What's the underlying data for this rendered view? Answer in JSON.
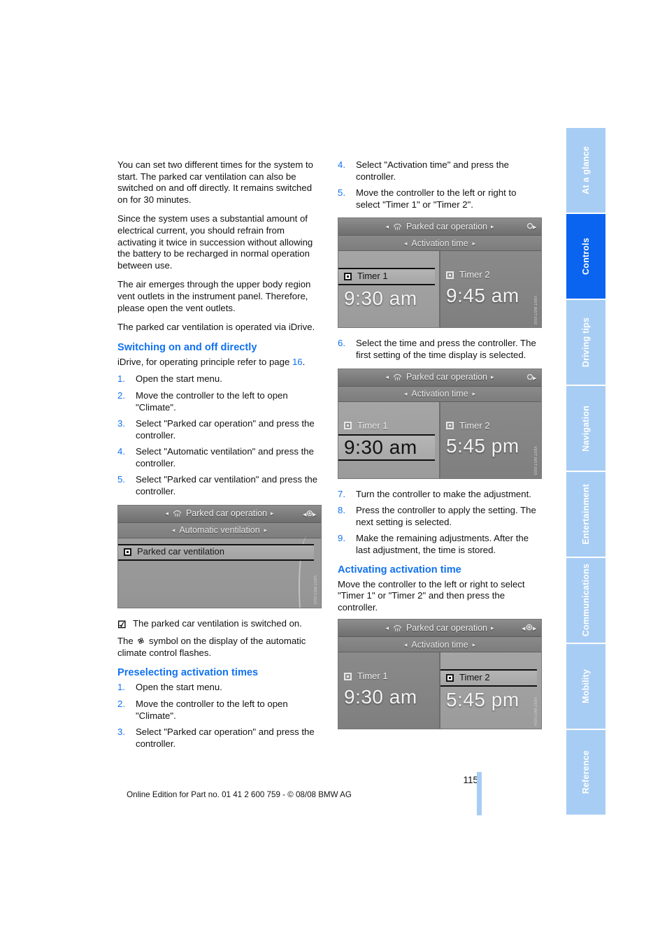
{
  "sidebar": {
    "items": [
      {
        "label": "At a glance",
        "active": false
      },
      {
        "label": "Controls",
        "active": true
      },
      {
        "label": "Driving tips",
        "active": false
      },
      {
        "label": "Navigation",
        "active": false
      },
      {
        "label": "Entertainment",
        "active": false
      },
      {
        "label": "Communications",
        "active": false
      },
      {
        "label": "Mobility",
        "active": false
      },
      {
        "label": "Reference",
        "active": false
      }
    ],
    "active_color": "#0a64f0",
    "inactive_color": "#a8cdf4"
  },
  "left_column": {
    "paragraphs": [
      "You can set two different times for the system to start. The parked car ventilation can also be switched on and off directly. It remains switched on for 30 minutes.",
      "Since the system uses a substantial amount of electrical current, you should refrain from activating it twice in succession without allowing the battery to be recharged in normal operation between use.",
      "The air emerges through the upper body region vent outlets in the instrument panel. Therefore, please open the vent outlets.",
      "The parked car ventilation is operated via iDrive."
    ],
    "heading_switching": "Switching on and off directly",
    "lead_switching_prefix": "iDrive, for operating principle refer to page ",
    "lead_switching_page": "16",
    "lead_switching_suffix": ".",
    "steps_switching": [
      {
        "num": "1.",
        "text": "Open the start menu."
      },
      {
        "num": "2.",
        "text": "Move the controller to the left to open \"Climate\"."
      },
      {
        "num": "3.",
        "text": "Select \"Parked car operation\" and press the controller."
      },
      {
        "num": "4.",
        "text": "Select \"Automatic ventilation\" and press the controller."
      },
      {
        "num": "5.",
        "text": "Select \"Parked car ventilation\" and press the controller."
      }
    ],
    "note_checkmark": "☑",
    "note_text": "The parked car ventilation is switched on.",
    "note_symbol_prefix": "The ",
    "note_symbol_suffix": " symbol on the display of the automatic climate control flashes.",
    "heading_preselect": "Preselecting activation times",
    "steps_preselect": [
      {
        "num": "1.",
        "text": "Open the start menu."
      },
      {
        "num": "2.",
        "text": "Move the controller to the left to open \"Climate\"."
      },
      {
        "num": "3.",
        "text": "Select \"Parked car operation\" and press the controller."
      }
    ]
  },
  "right_column": {
    "steps_top": [
      {
        "num": "4.",
        "text": "Select \"Activation time\" and press the controller."
      },
      {
        "num": "5.",
        "text": "Move the controller to the left or right to select \"Timer 1\" or \"Timer 2\"."
      }
    ],
    "steps_mid": [
      {
        "num": "6.",
        "text": "Select the time and press the controller. The first setting of the time display is selected."
      }
    ],
    "steps_bottom": [
      {
        "num": "7.",
        "text": "Turn the controller to make the adjustment."
      },
      {
        "num": "8.",
        "text": "Press the controller to apply the setting. The next setting is selected."
      },
      {
        "num": "9.",
        "text": "Make the remaining adjustments. After the last adjustment, the time is stored."
      }
    ],
    "heading_activating": "Activating activation time",
    "lead_activating": "Move the controller to the left or right to select \"Timer 1\" or \"Timer 2\" and then press the controller."
  },
  "screenshots": {
    "menu": {
      "header_title": "Parked car operation",
      "header_arrow_left": "◂",
      "header_arrow_right": "▸",
      "sub_title": "Automatic ventilation",
      "sub_arrow_left": "◂",
      "sub_arrow_right": "▸",
      "row_label": "Parked car ventilation",
      "code": "VERT.INST.0001"
    },
    "timer_a": {
      "header_title": "Parked car operation",
      "sub_title": "Activation time",
      "timer1_label": "Timer 1",
      "timer1_time": "9:30 am",
      "timer2_label": "Timer 2",
      "timer2_time": "9:45 am",
      "selected": "timer1-label",
      "code": "VERT.INST.0002"
    },
    "timer_b": {
      "header_title": "Parked car operation",
      "sub_title": "Activation time",
      "timer1_label": "Timer 1",
      "timer1_time": "9:30 am",
      "timer2_label": "Timer 2",
      "timer2_time": "5:45 pm",
      "selected": "timer1-time",
      "code": "VERT.INST.0003"
    },
    "timer_c": {
      "header_title": "Parked car operation",
      "sub_title": "Activation time",
      "timer1_label": "Timer 1",
      "timer1_time": "9:30 am",
      "timer2_label": "Timer 2",
      "timer2_time": "5:45 pm",
      "selected": "timer2-label",
      "code": "VERT.INST.0004"
    }
  },
  "footer": {
    "page_number": "115",
    "text": "Online Edition for Part no. 01 41 2 600 759 - © 08/08 BMW AG"
  }
}
